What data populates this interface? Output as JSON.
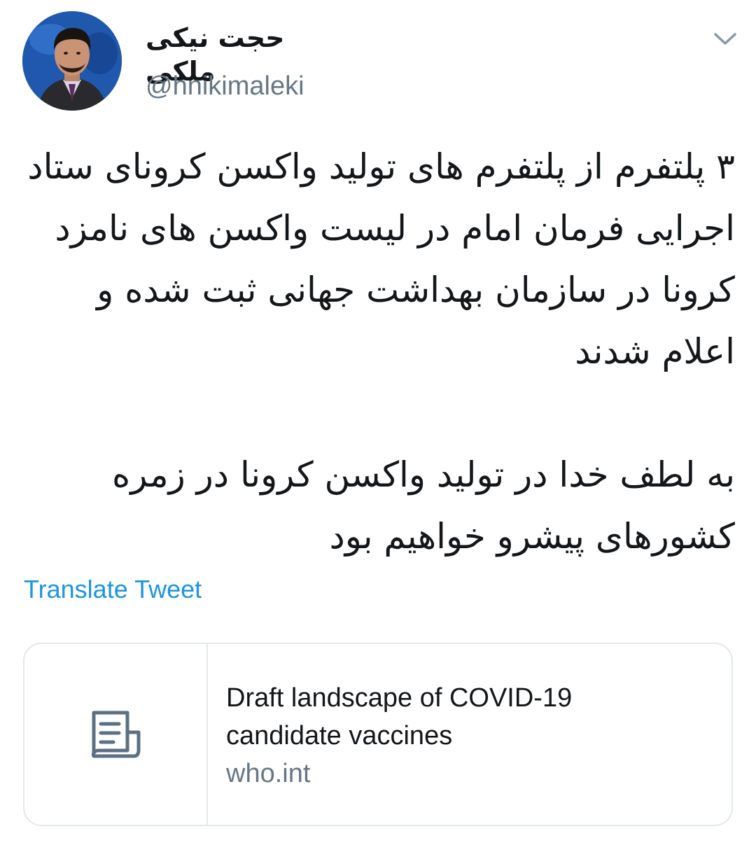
{
  "author": {
    "display_name": "حجت نیکی ملکی",
    "handle": "@hnikimaleki"
  },
  "tweet": {
    "paragraph_1": "۳ پلتفرم از پلتفرم های تولید واکسن کرونای ستاد اجرایی فرمان امام در لیست واکسن های نامزد کرونا در سازمان بهداشت جهانی ثبت شده و اعلام شدند",
    "paragraph_2": "به لطف خدا در تولید واکسن کرونا در زمره کشورهای پیشرو خواهیم بود"
  },
  "translate_label": "Translate Tweet",
  "link_card": {
    "title_line_1": "Draft landscape of COVID-19",
    "title_line_2": "candidate vaccines",
    "domain": "who.int",
    "thumbnail_icon": "document-icon"
  },
  "colors": {
    "link_blue": "#1b95e0",
    "secondary_text": "#657786",
    "border": "#e1e8ed",
    "primary_text": "#14171a"
  }
}
